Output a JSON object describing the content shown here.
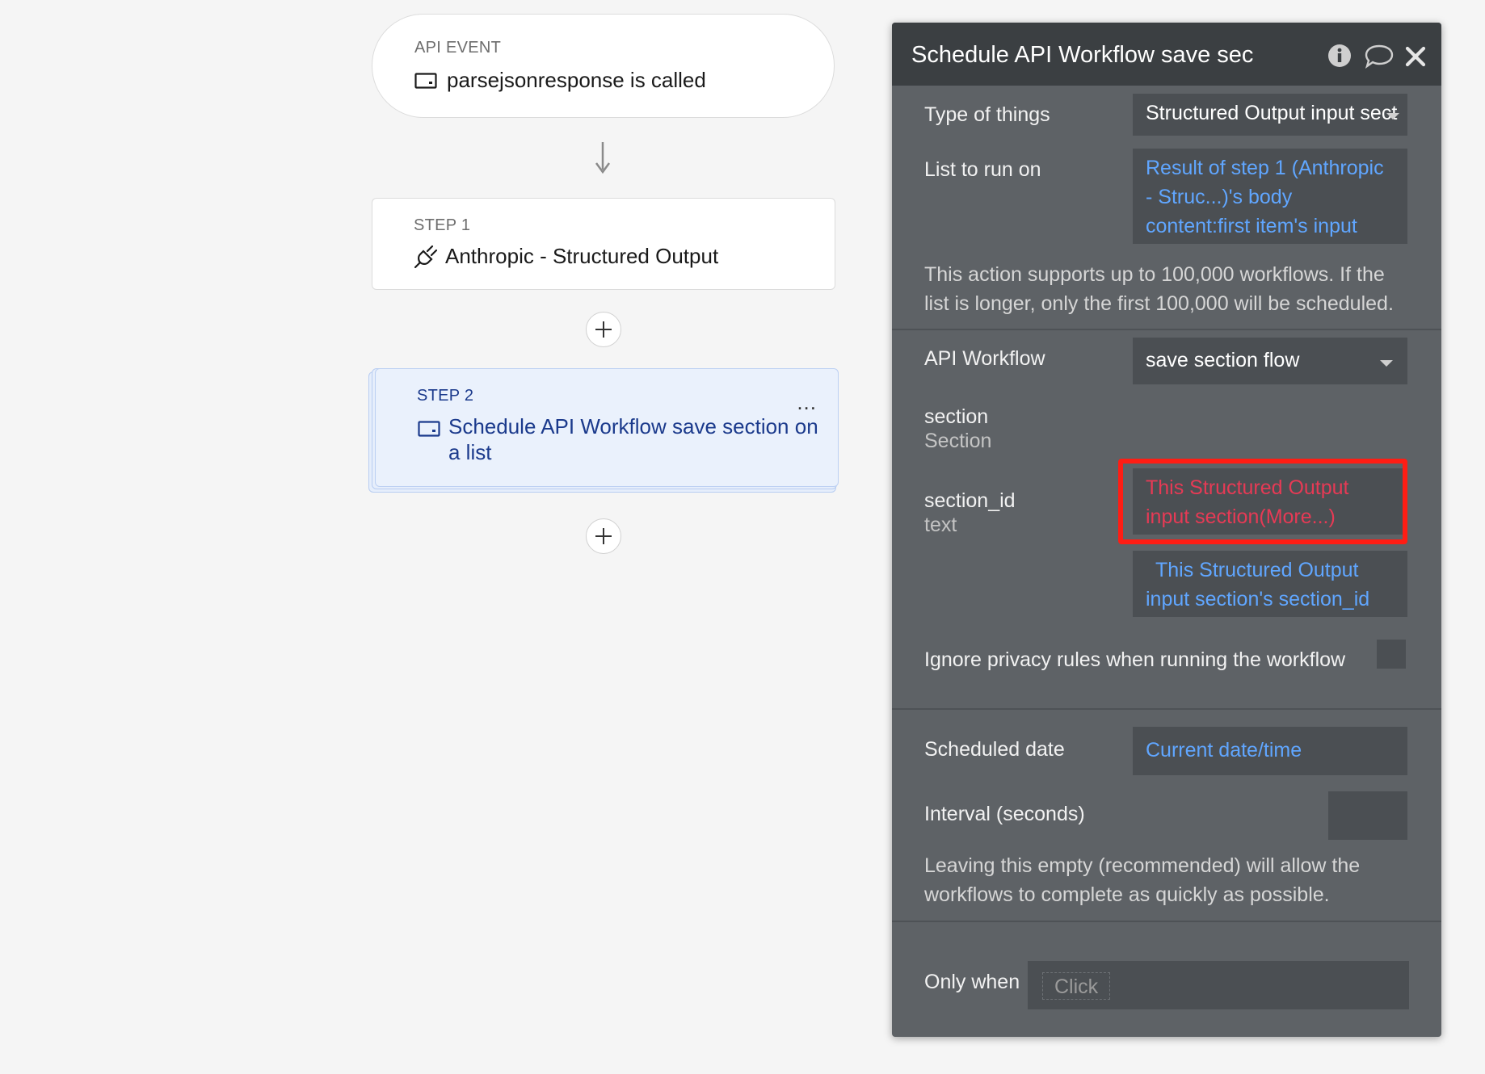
{
  "canvas": {
    "event": {
      "caption": "API EVENT",
      "title": "parsejsonresponse is called"
    },
    "step1": {
      "caption": "STEP 1",
      "title": "Anthropic - Structured Output"
    },
    "step2": {
      "caption": "STEP 2",
      "title": "Schedule API Workflow save section on a list",
      "more": "..."
    }
  },
  "panel": {
    "title": "Schedule API Workflow save sec",
    "icons": [
      "info-icon",
      "comment-icon",
      "close-icon"
    ],
    "type_of_things": {
      "label": "Type of things",
      "value": "Structured Output input sect"
    },
    "list_to_run_on": {
      "label": "List to run on",
      "value": "Result of step 1 (Anthropic - Struc...)'s body content:first item's input sections"
    },
    "list_note": "This action supports up to 100,000 workflows. If the list is longer, only the first 100,000 will be scheduled.",
    "api_workflow": {
      "label": "API Workflow",
      "value": "save section flow"
    },
    "section": {
      "label": "section",
      "type": "Section",
      "value": "This Structured Output input section(More...)"
    },
    "section_id": {
      "label": "section_id",
      "type": "text",
      "value": "This Structured Output input section's section_id"
    },
    "ignore_privacy": {
      "label": "Ignore privacy rules when running the workflow",
      "checked": false
    },
    "scheduled_date": {
      "label": "Scheduled date",
      "value": "Current date/time"
    },
    "interval": {
      "label": "Interval (seconds)",
      "value": ""
    },
    "interval_note": "Leaving this empty (recommended) will allow the workflows to complete as quickly as possible.",
    "only_when": {
      "label": "Only when",
      "placeholder": "Click"
    }
  },
  "colors": {
    "panel_bg": "#5e6266",
    "panel_header": "#3b3f42",
    "field_bg": "#4b4f53",
    "link_blue": "#60a6ff",
    "error_red": "#e63a55",
    "highlight": "#ff1d14",
    "step_blue": "#1b3a8c"
  }
}
